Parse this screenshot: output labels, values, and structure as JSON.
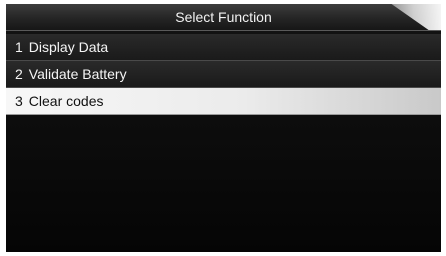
{
  "header": {
    "title": "Select Function"
  },
  "menu": {
    "items": [
      {
        "number": "1",
        "label": "Display Data",
        "selected": false
      },
      {
        "number": "2",
        "label": "Validate Battery",
        "selected": false
      },
      {
        "number": "3",
        "label": "Clear codes",
        "selected": true
      }
    ]
  },
  "colors": {
    "background": "#0b0b0b",
    "item_background": "#1f1f1f",
    "selected_background": "#eeeeee",
    "text": "#f5f5f5",
    "selected_text": "#111111"
  }
}
